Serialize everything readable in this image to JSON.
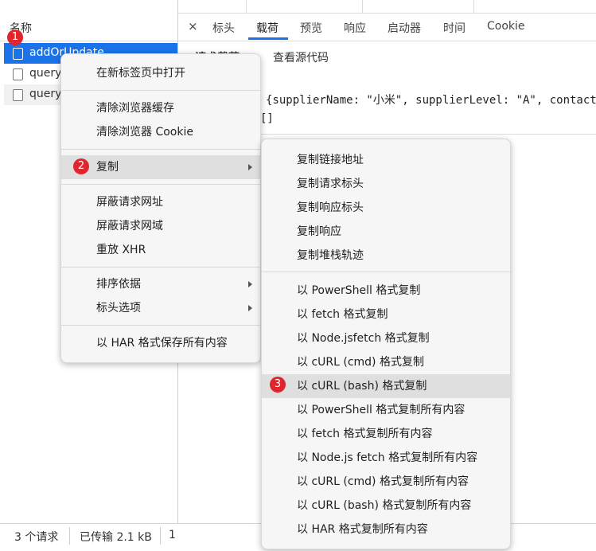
{
  "request_list": {
    "column_header": "名称",
    "rows": [
      "addOrUpdate",
      "query",
      "query"
    ]
  },
  "status_bar": {
    "requests": "3 个请求",
    "transferred": "已传输 2.1 kB",
    "extra": "1"
  },
  "detail": {
    "close_glyph": "×",
    "tabs": [
      "标头",
      "载荷",
      "预览",
      "响应",
      "启动器",
      "时间",
      "Cookie"
    ],
    "active_tab": "载荷",
    "subtabs": [
      "请求载荷",
      "查看源代码"
    ],
    "payload_line": "{supplierName: \"小米\", supplierLevel: \"A\", contact",
    "payload_line2": "[]"
  },
  "context_menu": {
    "items": [
      "在新标签页中打开",
      "清除浏览器缓存",
      "清除浏览器 Cookie",
      "复制",
      "屏蔽请求网址",
      "屏蔽请求网域",
      "重放 XHR",
      "排序依据",
      "标头选项",
      "以 HAR 格式保存所有内容"
    ]
  },
  "copy_submenu": {
    "items": [
      "复制链接地址",
      "复制请求标头",
      "复制响应标头",
      "复制响应",
      "复制堆栈轨迹",
      "以 PowerShell 格式复制",
      "以 fetch 格式复制",
      "以 Node.jsfetch 格式复制",
      "以 cURL (cmd) 格式复制",
      "以 cURL (bash) 格式复制",
      "以 PowerShell 格式复制所有内容",
      "以 fetch 格式复制所有内容",
      "以 Node.js fetch 格式复制所有内容",
      "以 cURL (cmd) 格式复制所有内容",
      "以 cURL (bash) 格式复制所有内容",
      "以 HAR 格式复制所有内容"
    ]
  },
  "step_badges": [
    "1",
    "2",
    "3"
  ],
  "colors": {
    "selection_blue": "#1a73e8",
    "badge_red": "#e0262c",
    "menu_bg": "#f6f6f6",
    "menu_highlight": "#dfdfdf"
  }
}
